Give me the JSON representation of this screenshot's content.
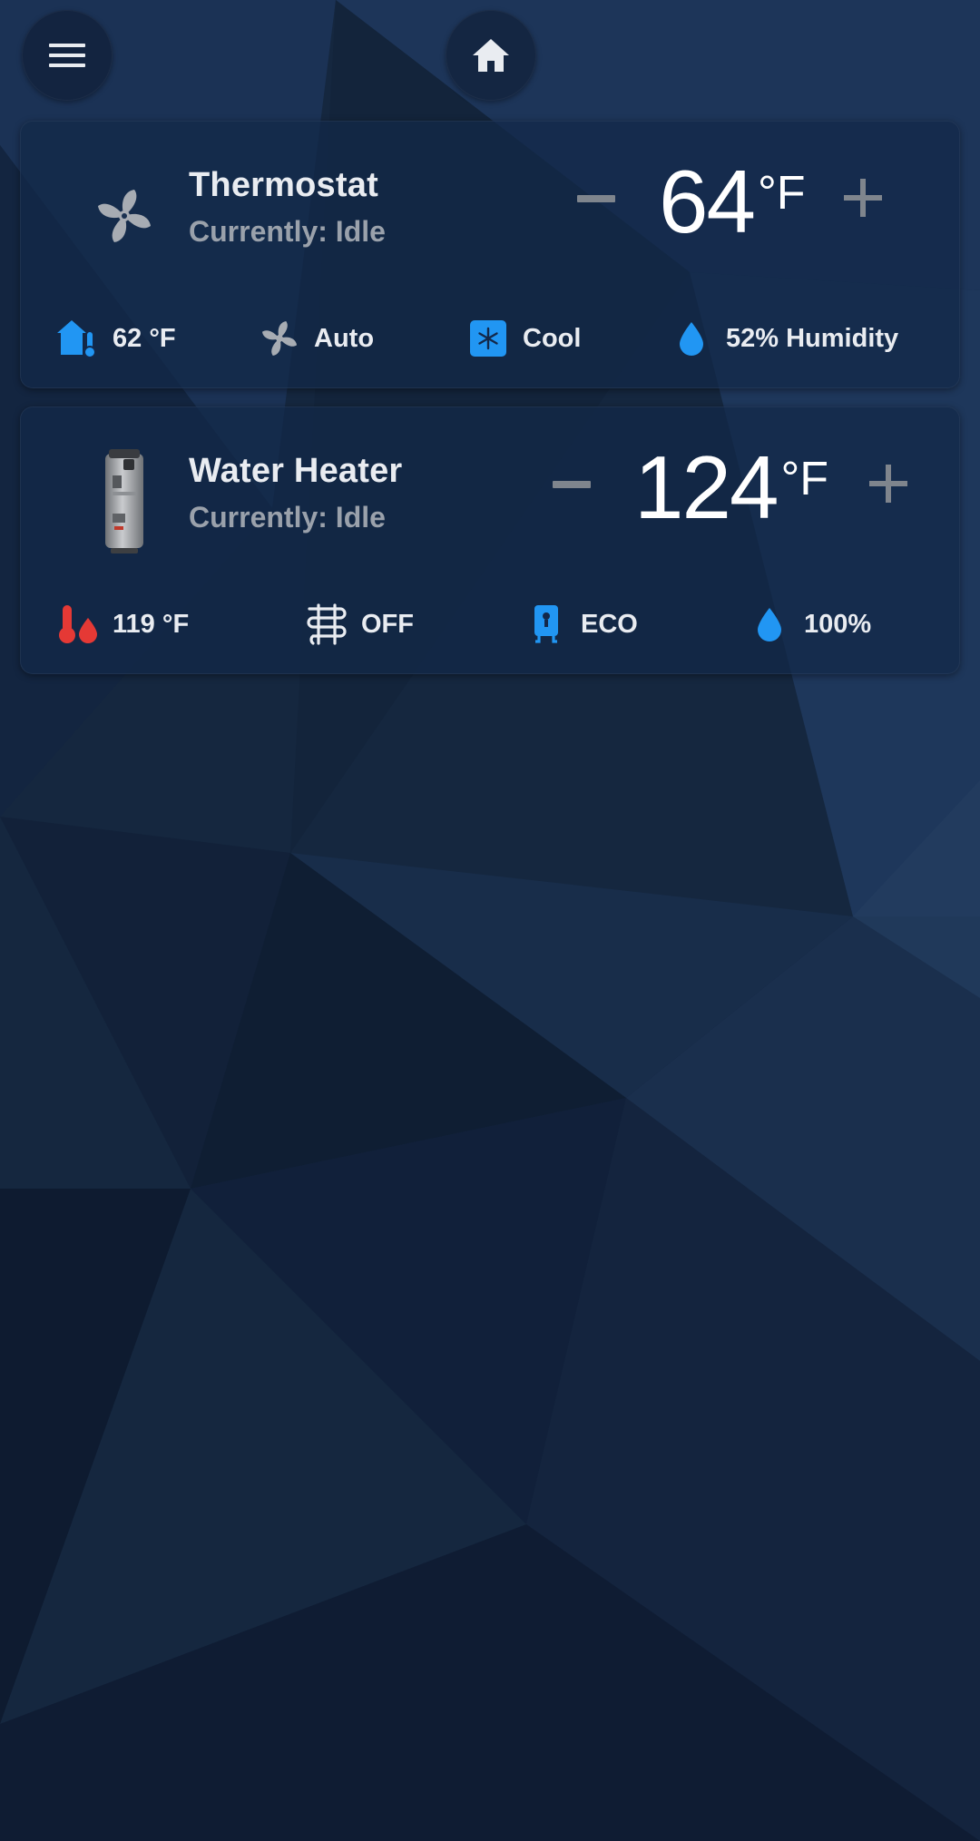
{
  "header": {
    "menu_icon": "menu-icon",
    "home_icon": "home-icon"
  },
  "thermostat": {
    "name": "Thermostat",
    "status": "Currently: Idle",
    "setpoint": "64",
    "unit": "°F",
    "icon": "fan-icon",
    "stats": [
      {
        "icon": "home-thermometer-icon",
        "label": "62 °F"
      },
      {
        "icon": "fan-icon",
        "label": "Auto"
      },
      {
        "icon": "snowflake-icon",
        "label": "Cool"
      },
      {
        "icon": "water-drop-icon",
        "label": "52% Humidity"
      }
    ]
  },
  "water_heater": {
    "name": "Water Heater",
    "status": "Currently: Idle",
    "setpoint": "124",
    "unit": "°F",
    "icon": "water-heater-image",
    "stats": [
      {
        "icon": "thermometer-water-icon",
        "label": "119 °F"
      },
      {
        "icon": "heating-coil-icon",
        "label": "OFF"
      },
      {
        "icon": "water-boiler-icon",
        "label": "ECO"
      },
      {
        "icon": "water-drop-icon",
        "label": "100%"
      }
    ]
  },
  "colors": {
    "accent_blue": "#2196f3",
    "hot_red": "#e53935",
    "muted_gray": "#9aa1ab",
    "text_white": "#e9ecf1"
  }
}
